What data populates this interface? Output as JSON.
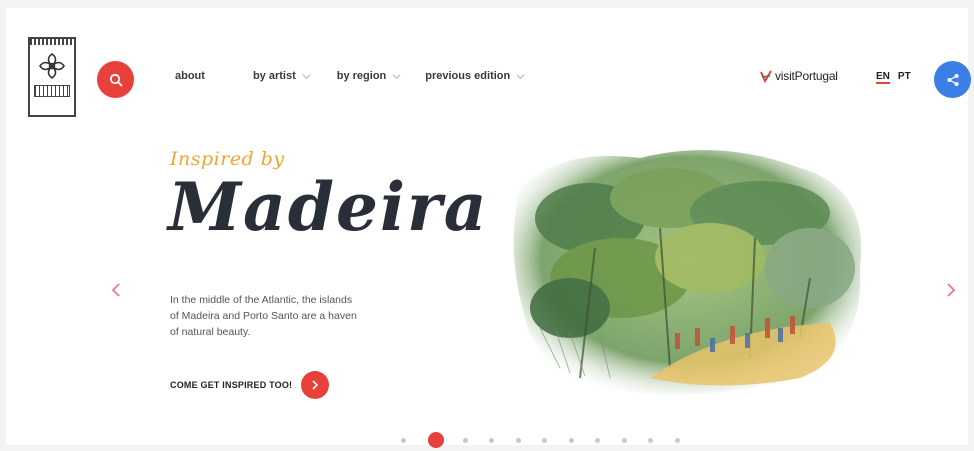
{
  "header": {
    "nav": [
      {
        "label": "about",
        "dropdown": false
      },
      {
        "label": "by artist",
        "dropdown": true
      },
      {
        "label": "by region",
        "dropdown": true
      },
      {
        "label": "previous edition",
        "dropdown": true
      }
    ],
    "partner_label": "visitPortugal",
    "languages": [
      "EN",
      "PT"
    ],
    "active_language": "EN"
  },
  "hero": {
    "eyebrow": "Inspired by",
    "title": "Madeira",
    "description": "In the middle of the Atlantic, the islands of Madeira and Porto Santo are a haven of natural beauty.",
    "cta_label": "COME GET INSPIRED TOO!"
  },
  "carousel": {
    "total_slides": 11,
    "active_index": 1
  },
  "colors": {
    "accent_red": "#e8403a",
    "accent_orange": "#f0a531",
    "share_blue": "#3b7fe6",
    "title_dark": "#2a2e38"
  },
  "icons": {
    "search": "search-icon",
    "share": "share-icon",
    "chevron": "chevron-down-icon",
    "prev": "chevron-left-icon",
    "next": "chevron-right-icon",
    "cta": "chevron-right-icon"
  }
}
